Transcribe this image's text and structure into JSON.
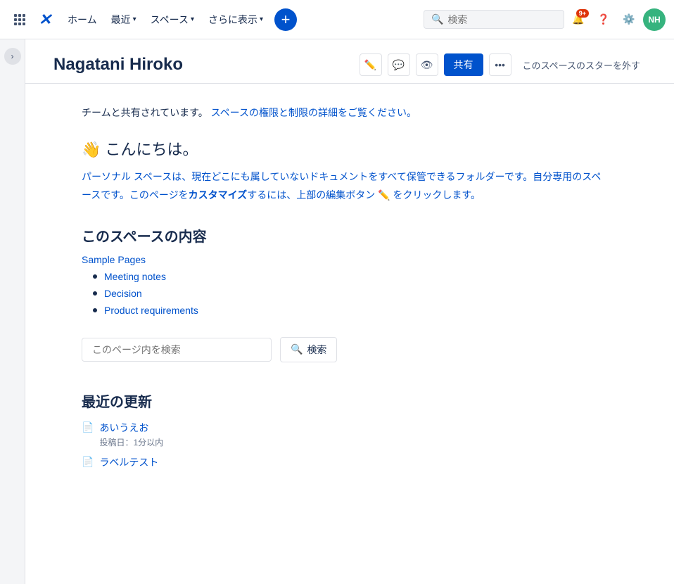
{
  "topnav": {
    "home_label": "ホーム",
    "recent_label": "最近",
    "spaces_label": "スペース",
    "more_label": "さらに表示",
    "search_placeholder": "検索",
    "notification_count": "9+",
    "avatar_initials": "NH"
  },
  "page": {
    "title": "Nagatani Hiroko",
    "share_button": "共有",
    "star_button": "このスペースのスターを外す",
    "share_notice": "チームと共有されています。",
    "share_notice_link": "スペースの権限と制限の詳細をご覧ください。",
    "greeting": "👋 こんにちは。",
    "description": "パーソナル スペースは、現在どこにも属していないドキュメントをすべて保管できるフォルダーです。自分専用のスペースです。このページを",
    "description_bold": "カスタマイズ",
    "description_suffix": "するには、上部の編集ボタン ✏️ をクリックします。",
    "section_title": "このスペースの内容",
    "sample_pages_link": "Sample Pages",
    "pages_list": [
      {
        "label": "Meeting notes",
        "href": "#"
      },
      {
        "label": "Decision",
        "href": "#"
      },
      {
        "label": "Product requirements",
        "href": "#"
      }
    ],
    "search_placeholder_page": "このページ内を検索",
    "search_button": "検索",
    "recent_title": "最近の更新",
    "recent_items": [
      {
        "label": "あいうえお",
        "meta": "投稿日：1分以内"
      },
      {
        "label": "ラベルテスト",
        "meta": ""
      }
    ]
  }
}
